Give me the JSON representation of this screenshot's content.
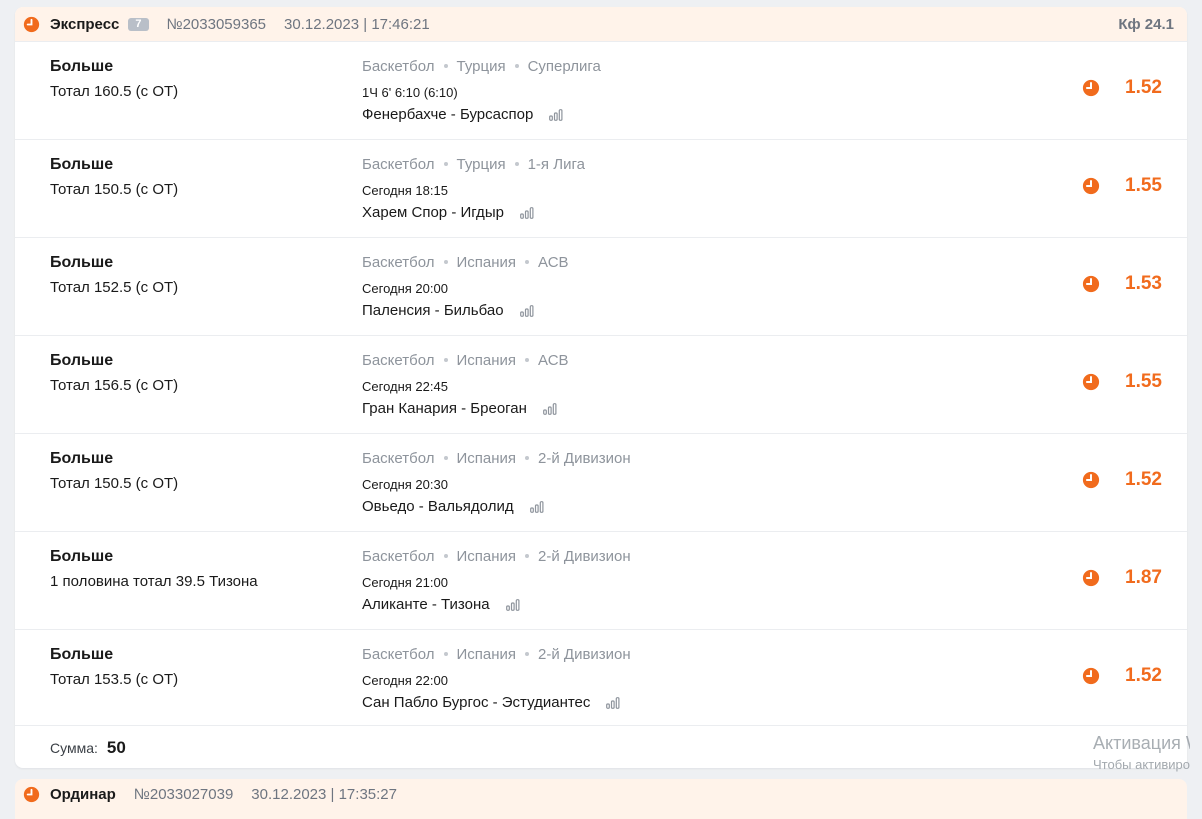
{
  "colors": {
    "accent": "#f16b1d",
    "header_bg": "#fff3ea",
    "muted": "#8e949c"
  },
  "express": {
    "type": "Экспресс",
    "count": "7",
    "number": "№2033059365",
    "datetime": "30.12.2023 | 17:46:21",
    "kf": "Кф 24.1",
    "status_icon": "clock-icon",
    "rows": [
      {
        "outcome": "Больше",
        "market": "Тотал 160.5 (с ОТ)",
        "sport": "Баскетбол",
        "country": "Турция",
        "league": "Суперлига",
        "time": "1Ч 6' 6:10 (6:10)",
        "match": "Фенербахче - Бурсаспор",
        "odds": "1.52"
      },
      {
        "outcome": "Больше",
        "market": "Тотал 150.5 (с ОТ)",
        "sport": "Баскетбол",
        "country": "Турция",
        "league": "1-я Лига",
        "time": "Сегодня 18:15",
        "match": "Харем Спор - Игдыр",
        "odds": "1.55"
      },
      {
        "outcome": "Больше",
        "market": "Тотал 152.5 (с ОТ)",
        "sport": "Баскетбол",
        "country": "Испания",
        "league": "АСВ",
        "time": "Сегодня 20:00",
        "match": "Паленсия - Бильбао",
        "odds": "1.53"
      },
      {
        "outcome": "Больше",
        "market": "Тотал 156.5 (с ОТ)",
        "sport": "Баскетбол",
        "country": "Испания",
        "league": "АСВ",
        "time": "Сегодня 22:45",
        "match": "Гран Канария - Бреоган",
        "odds": "1.55"
      },
      {
        "outcome": "Больше",
        "market": "Тотал 150.5 (с ОТ)",
        "sport": "Баскетбол",
        "country": "Испания",
        "league": "2-й Дивизион",
        "time": "Сегодня 20:30",
        "match": "Овьедо - Вальядолид",
        "odds": "1.52"
      },
      {
        "outcome": "Больше",
        "market": "1 половина тотал 39.5 Тизона",
        "sport": "Баскетбол",
        "country": "Испания",
        "league": "2-й Дивизион",
        "time": "Сегодня 21:00",
        "match": "Аликанте - Тизона",
        "odds": "1.87"
      },
      {
        "outcome": "Больше",
        "market": "Тотал 153.5 (с ОТ)",
        "sport": "Баскетбол",
        "country": "Испания",
        "league": "2-й Дивизион",
        "time": "Сегодня 22:00",
        "match": "Сан Пабло Бургос - Эстудиантес",
        "odds": "1.52"
      }
    ],
    "sum_label": "Сумма:",
    "sum_value": "50"
  },
  "single": {
    "type": "Ординар",
    "number": "№2033027039",
    "datetime": "30.12.2023 | 17:35:27"
  },
  "windows_activation": {
    "title": "Активация W",
    "subtitle": "Чтобы активиро"
  }
}
